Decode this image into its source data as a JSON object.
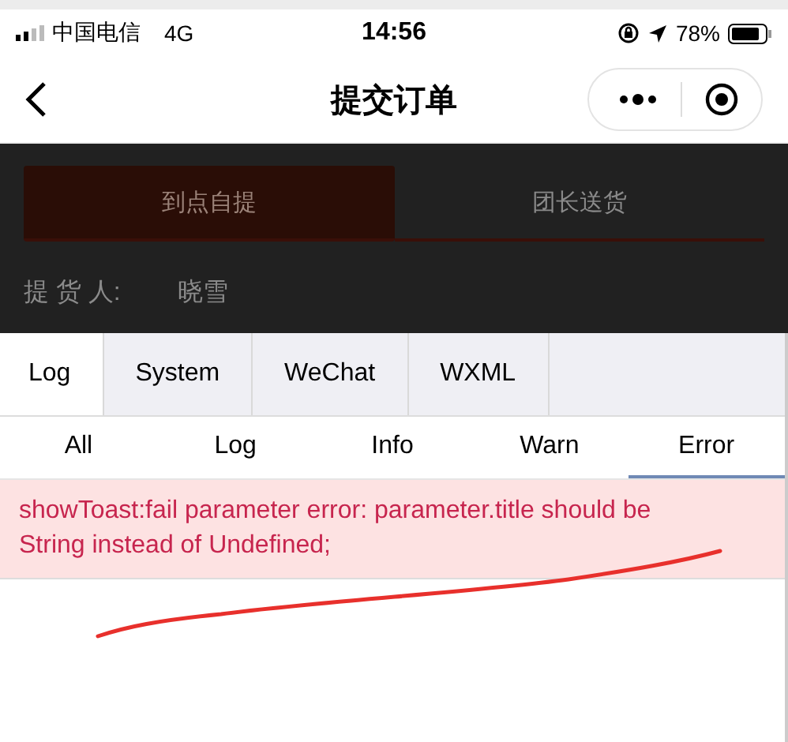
{
  "status_bar": {
    "carrier": "中国电信",
    "network": "4G",
    "time": "14:56",
    "battery": "78%"
  },
  "nav": {
    "title": "提交订单"
  },
  "page_behind": {
    "delivery_tabs": [
      {
        "label": "到点自提",
        "selected": true
      },
      {
        "label": "团长送货",
        "selected": false
      }
    ],
    "pickup": {
      "label": "提 货 人:",
      "value": "晓雪"
    }
  },
  "console": {
    "tabs": [
      {
        "label": "Log",
        "selected": true
      },
      {
        "label": "System",
        "selected": false
      },
      {
        "label": "WeChat",
        "selected": false
      },
      {
        "label": "WXML",
        "selected": false
      }
    ],
    "filters": [
      {
        "label": "All",
        "selected": false
      },
      {
        "label": "Log",
        "selected": false
      },
      {
        "label": "Info",
        "selected": false
      },
      {
        "label": "Warn",
        "selected": false
      },
      {
        "label": "Error",
        "selected": true
      }
    ],
    "logs": [
      {
        "kind": "error",
        "text": "showToast:fail parameter error: parameter.title should be String instead of Undefined;"
      }
    ]
  }
}
